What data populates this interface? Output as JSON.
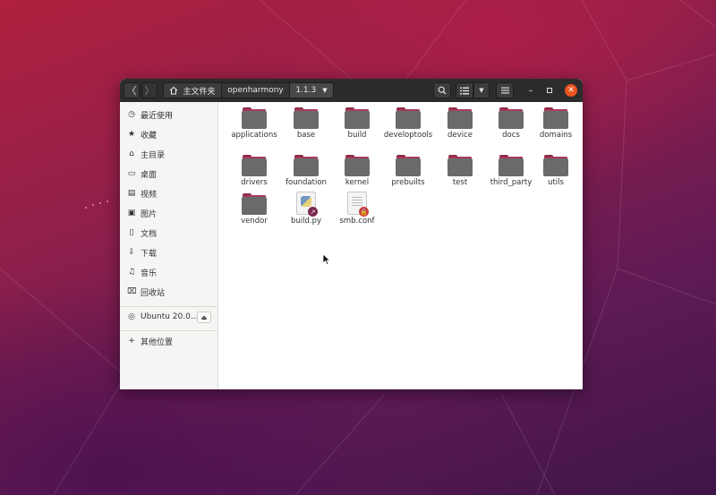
{
  "header": {
    "back_icon": "chevron-left",
    "forward_icon": "chevron-right",
    "breadcrumb": [
      {
        "label": "主文件夹",
        "icon": "home-icon"
      },
      {
        "label": "openharmony"
      },
      {
        "label": "1.1.3"
      }
    ],
    "toolbar_icons": [
      "search-icon",
      "list-view-icon",
      "chevron-down-icon",
      "menu-icon"
    ],
    "window_controls": [
      "minimize-icon",
      "maximize-icon",
      "close-icon"
    ]
  },
  "sidebar": {
    "places": [
      {
        "label": "最近使用",
        "icon": "clock-icon"
      },
      {
        "label": "收藏",
        "icon": "star-icon"
      },
      {
        "label": "主目录",
        "icon": "home-icon"
      },
      {
        "label": "桌面",
        "icon": "desktop-icon"
      },
      {
        "label": "视频",
        "icon": "video-icon"
      },
      {
        "label": "图片",
        "icon": "picture-icon"
      },
      {
        "label": "文档",
        "icon": "document-icon"
      },
      {
        "label": "下载",
        "icon": "download-icon"
      },
      {
        "label": "音乐",
        "icon": "music-icon"
      },
      {
        "label": "回收站",
        "icon": "trash-icon"
      }
    ],
    "devices": [
      {
        "label": "Ubuntu 20.0...",
        "icon": "disc-icon",
        "action_icon": "eject-icon"
      }
    ],
    "other": {
      "label": "其他位置",
      "icon": "plus-icon"
    }
  },
  "files": [
    {
      "name": "applications",
      "type": "folder"
    },
    {
      "name": "base",
      "type": "folder"
    },
    {
      "name": "build",
      "type": "folder"
    },
    {
      "name": "developtools",
      "type": "folder"
    },
    {
      "name": "device",
      "type": "folder"
    },
    {
      "name": "docs",
      "type": "folder"
    },
    {
      "name": "domains",
      "type": "folder"
    },
    {
      "name": "drivers",
      "type": "folder"
    },
    {
      "name": "foundation",
      "type": "folder"
    },
    {
      "name": "kernel",
      "type": "folder"
    },
    {
      "name": "prebuilts",
      "type": "folder"
    },
    {
      "name": "test",
      "type": "folder"
    },
    {
      "name": "third_party",
      "type": "folder"
    },
    {
      "name": "utils",
      "type": "folder"
    },
    {
      "name": "vendor",
      "type": "folder"
    },
    {
      "name": "build.py",
      "type": "symlink-python"
    },
    {
      "name": "smb.conf",
      "type": "locked-text"
    }
  ],
  "colors": {
    "folder_accent": "#a83a5a",
    "folder_body": "#6a6a6a",
    "headerbar": "#2c2c2c",
    "close_button": "#e95420",
    "symlink_emblem": "#7b2a4f",
    "lock_emblem": "#d33c3c"
  }
}
